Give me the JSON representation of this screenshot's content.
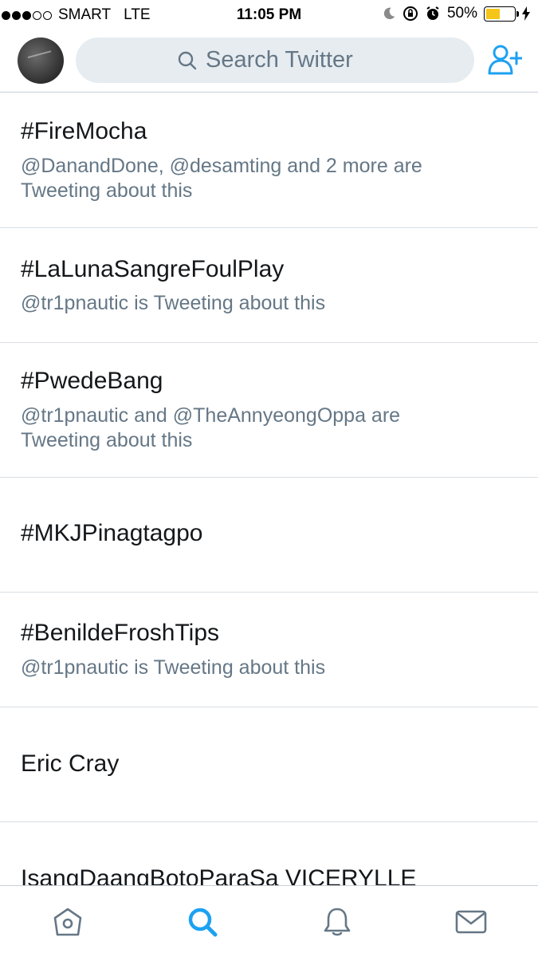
{
  "status_bar": {
    "carrier": "SMART",
    "network": "LTE",
    "time": "11:05 PM",
    "battery_percent": "50%",
    "battery_level": 0.5,
    "signal_bars_filled": 3,
    "signal_bars_total": 5,
    "icons": [
      "moon-icon",
      "rotation-lock-icon",
      "alarm-icon",
      "charging-icon"
    ]
  },
  "header": {
    "search_placeholder": "Search Twitter",
    "icons": [
      "search-icon",
      "add-user-icon"
    ]
  },
  "trends": [
    {
      "name": "#FireMocha",
      "meta": "@DanandDone, @desamting and 2 more are Tweeting about this"
    },
    {
      "name": "#LaLunaSangreFoulPlay",
      "meta": "@tr1pnautic is Tweeting about this"
    },
    {
      "name": "#PwedeBang",
      "meta": "@tr1pnautic and @TheAnnyeongOppa are Tweeting about this"
    },
    {
      "name": "#MKJPinagtagpo",
      "meta": ""
    },
    {
      "name": "#BenildeFroshTips",
      "meta": "@tr1pnautic is Tweeting about this"
    },
    {
      "name": "Eric Cray",
      "meta": ""
    },
    {
      "name": "IsangDaangBotoParaSa VICERYLLE",
      "meta": ""
    }
  ],
  "tab_bar": {
    "active_tab": "search",
    "tabs": [
      "home",
      "search",
      "notifications",
      "messages"
    ],
    "active_color": "#1da1f2",
    "inactive_color": "#657786"
  }
}
